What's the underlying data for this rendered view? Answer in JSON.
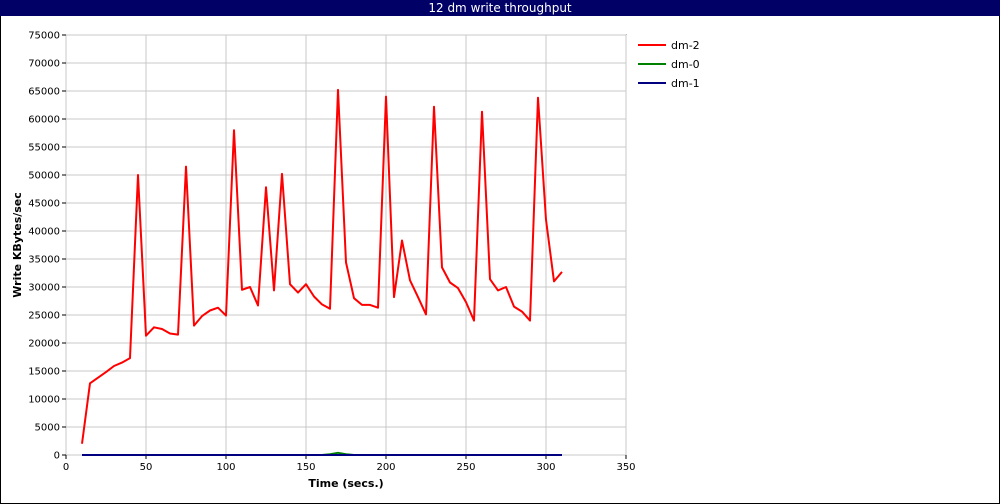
{
  "chart_data": {
    "type": "line",
    "title": "12 dm write throughput",
    "xlabel": "Time (secs.)",
    "ylabel": "Write KBytes/sec",
    "xlim": [
      0,
      350
    ],
    "ylim": [
      0,
      75000
    ],
    "x_ticks": [
      0,
      50,
      100,
      150,
      200,
      250,
      300,
      350
    ],
    "y_ticks": [
      0,
      5000,
      10000,
      15000,
      20000,
      25000,
      30000,
      35000,
      40000,
      45000,
      50000,
      55000,
      60000,
      65000,
      70000,
      75000
    ],
    "grid": true,
    "legend_position": "top-right",
    "series": [
      {
        "name": "dm-2",
        "color": "#ff0000",
        "points": [
          [
            10,
            2000
          ],
          [
            15,
            12800
          ],
          [
            20,
            13800
          ],
          [
            25,
            14800
          ],
          [
            30,
            15900
          ],
          [
            35,
            16500
          ],
          [
            40,
            17300
          ],
          [
            45,
            50000
          ],
          [
            50,
            21300
          ],
          [
            55,
            22800
          ],
          [
            60,
            22500
          ],
          [
            65,
            21700
          ],
          [
            70,
            21500
          ],
          [
            75,
            51500
          ],
          [
            80,
            23100
          ],
          [
            85,
            24800
          ],
          [
            90,
            25800
          ],
          [
            95,
            26300
          ],
          [
            100,
            24900
          ],
          [
            105,
            58000
          ],
          [
            110,
            29500
          ],
          [
            115,
            30000
          ],
          [
            120,
            26700
          ],
          [
            125,
            47800
          ],
          [
            130,
            29400
          ],
          [
            135,
            50200
          ],
          [
            140,
            30500
          ],
          [
            145,
            29000
          ],
          [
            150,
            30500
          ],
          [
            155,
            28300
          ],
          [
            160,
            26900
          ],
          [
            165,
            26100
          ],
          [
            170,
            65200
          ],
          [
            175,
            34400
          ],
          [
            180,
            28000
          ],
          [
            185,
            26800
          ],
          [
            190,
            26800
          ],
          [
            195,
            26300
          ],
          [
            200,
            64000
          ],
          [
            205,
            28200
          ],
          [
            210,
            38300
          ],
          [
            215,
            31200
          ],
          [
            220,
            28200
          ],
          [
            225,
            25100
          ],
          [
            230,
            62200
          ],
          [
            235,
            33500
          ],
          [
            240,
            30800
          ],
          [
            245,
            29800
          ],
          [
            250,
            27300
          ],
          [
            255,
            24000
          ],
          [
            260,
            61300
          ],
          [
            265,
            31400
          ],
          [
            270,
            29400
          ],
          [
            275,
            30000
          ],
          [
            280,
            26500
          ],
          [
            285,
            25600
          ],
          [
            290,
            24000
          ],
          [
            295,
            63800
          ],
          [
            300,
            42000
          ],
          [
            305,
            31000
          ],
          [
            310,
            32700
          ]
        ]
      },
      {
        "name": "dm-0",
        "color": "#008000",
        "points": [
          [
            10,
            0
          ],
          [
            160,
            0
          ],
          [
            165,
            150
          ],
          [
            170,
            400
          ],
          [
            175,
            150
          ],
          [
            180,
            0
          ],
          [
            310,
            0
          ]
        ]
      },
      {
        "name": "dm-1",
        "color": "#000080",
        "points": [
          [
            10,
            0
          ],
          [
            310,
            0
          ]
        ]
      }
    ]
  }
}
